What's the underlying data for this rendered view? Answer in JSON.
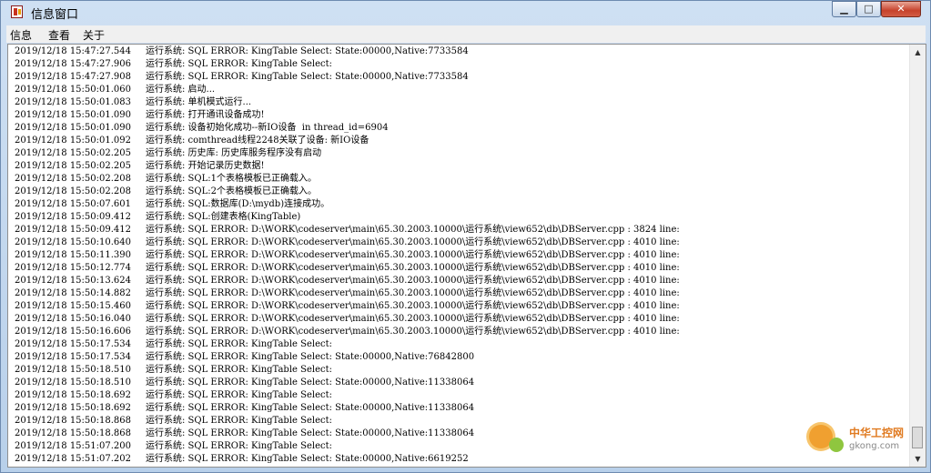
{
  "window": {
    "title": "信息窗口"
  },
  "menu": [
    "信息",
    "查看",
    "关于"
  ],
  "log": [
    {
      "time": "2019/12/18 15:47:27.544",
      "msg": "运行系统: SQL ERROR: KingTable Select: State:00000,Native:7733584"
    },
    {
      "time": "2019/12/18 15:47:27.906",
      "msg": "运行系统: SQL ERROR: KingTable Select:"
    },
    {
      "time": "2019/12/18 15:47:27.908",
      "msg": "运行系统: SQL ERROR: KingTable Select: State:00000,Native:7733584"
    },
    {
      "time": "2019/12/18 15:50:01.060",
      "msg": "运行系统: 启动..."
    },
    {
      "time": "2019/12/18 15:50:01.083",
      "msg": "运行系统: 单机模式运行..."
    },
    {
      "time": "2019/12/18 15:50:01.090",
      "msg": "运行系统: 打开通讯设备成功!"
    },
    {
      "time": "2019/12/18 15:50:01.090",
      "msg": "运行系统: 设备初始化成功--新IO设备  in thread_id=6904"
    },
    {
      "time": "2019/12/18 15:50:01.092",
      "msg": "运行系统: comthread线程2248关联了设备: 新IO设备"
    },
    {
      "time": "2019/12/18 15:50:02.205",
      "msg": "运行系统: 历史库: 历史库服务程序没有启动"
    },
    {
      "time": "2019/12/18 15:50:02.205",
      "msg": "运行系统: 开始记录历史数据!"
    },
    {
      "time": "2019/12/18 15:50:02.208",
      "msg": "运行系统: SQL:1个表格模板已正确载入。"
    },
    {
      "time": "2019/12/18 15:50:02.208",
      "msg": "运行系统: SQL:2个表格模板已正确载入。"
    },
    {
      "time": "2019/12/18 15:50:07.601",
      "msg": "运行系统: SQL:数据库(D:\\mydb)连接成功。"
    },
    {
      "time": "2019/12/18 15:50:09.412",
      "msg": "运行系统: SQL:创建表格(KingTable)"
    },
    {
      "time": "2019/12/18 15:50:09.412",
      "msg": "运行系统: SQL ERROR: D:\\WORK\\codeserver\\main\\65.30.2003.10000\\运行系统\\view652\\db\\DBServer.cpp : 3824 line:"
    },
    {
      "time": "2019/12/18 15:50:10.640",
      "msg": "运行系统: SQL ERROR: D:\\WORK\\codeserver\\main\\65.30.2003.10000\\运行系统\\view652\\db\\DBServer.cpp : 4010 line:"
    },
    {
      "time": "2019/12/18 15:50:11.390",
      "msg": "运行系统: SQL ERROR: D:\\WORK\\codeserver\\main\\65.30.2003.10000\\运行系统\\view652\\db\\DBServer.cpp : 4010 line:"
    },
    {
      "time": "2019/12/18 15:50:12.774",
      "msg": "运行系统: SQL ERROR: D:\\WORK\\codeserver\\main\\65.30.2003.10000\\运行系统\\view652\\db\\DBServer.cpp : 4010 line:"
    },
    {
      "time": "2019/12/18 15:50:13.624",
      "msg": "运行系统: SQL ERROR: D:\\WORK\\codeserver\\main\\65.30.2003.10000\\运行系统\\view652\\db\\DBServer.cpp : 4010 line:"
    },
    {
      "time": "2019/12/18 15:50:14.882",
      "msg": "运行系统: SQL ERROR: D:\\WORK\\codeserver\\main\\65.30.2003.10000\\运行系统\\view652\\db\\DBServer.cpp : 4010 line:"
    },
    {
      "time": "2019/12/18 15:50:15.460",
      "msg": "运行系统: SQL ERROR: D:\\WORK\\codeserver\\main\\65.30.2003.10000\\运行系统\\view652\\db\\DBServer.cpp : 4010 line:"
    },
    {
      "time": "2019/12/18 15:50:16.040",
      "msg": "运行系统: SQL ERROR: D:\\WORK\\codeserver\\main\\65.30.2003.10000\\运行系统\\view652\\db\\DBServer.cpp : 4010 line:"
    },
    {
      "time": "2019/12/18 15:50:16.606",
      "msg": "运行系统: SQL ERROR: D:\\WORK\\codeserver\\main\\65.30.2003.10000\\运行系统\\view652\\db\\DBServer.cpp : 4010 line:"
    },
    {
      "time": "2019/12/18 15:50:17.534",
      "msg": "运行系统: SQL ERROR: KingTable Select:"
    },
    {
      "time": "2019/12/18 15:50:17.534",
      "msg": "运行系统: SQL ERROR: KingTable Select: State:00000,Native:76842800"
    },
    {
      "time": "2019/12/18 15:50:18.510",
      "msg": "运行系统: SQL ERROR: KingTable Select:"
    },
    {
      "time": "2019/12/18 15:50:18.510",
      "msg": "运行系统: SQL ERROR: KingTable Select: State:00000,Native:11338064"
    },
    {
      "time": "2019/12/18 15:50:18.692",
      "msg": "运行系统: SQL ERROR: KingTable Select:"
    },
    {
      "time": "2019/12/18 15:50:18.692",
      "msg": "运行系统: SQL ERROR: KingTable Select: State:00000,Native:11338064"
    },
    {
      "time": "2019/12/18 15:50:18.868",
      "msg": "运行系统: SQL ERROR: KingTable Select:"
    },
    {
      "time": "2019/12/18 15:50:18.868",
      "msg": "运行系统: SQL ERROR: KingTable Select: State:00000,Native:11338064"
    },
    {
      "time": "2019/12/18 15:51:07.200",
      "msg": "运行系统: SQL ERROR: KingTable Select:"
    },
    {
      "time": "2019/12/18 15:51:07.202",
      "msg": "运行系统: SQL ERROR: KingTable Select: State:00000,Native:6619252"
    }
  ],
  "watermark": {
    "cn": "中华工控网",
    "en": "gkong.com"
  }
}
